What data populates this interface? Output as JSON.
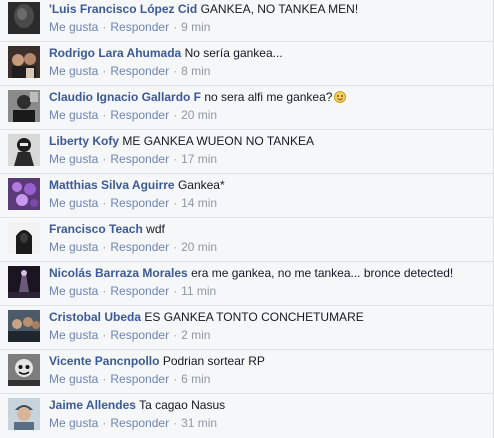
{
  "comments": [
    {
      "author": "'Luis Francisco López Cid",
      "text": "GANKEA, NO TANKEA MEN!",
      "like": "Me gusta",
      "reply": "Responder",
      "time": "9 min",
      "avatar": "dark-blur"
    },
    {
      "author": "Rodrigo Lara Ahumada",
      "text": "No sería gankea...",
      "like": "Me gusta",
      "reply": "Responder",
      "time": "8 min",
      "avatar": "person-group"
    },
    {
      "author": "Claudio Ignacio Gallardo F",
      "text": "no sera alfi me gankea?",
      "like": "Me gusta",
      "reply": "Responder",
      "time": "20 min",
      "avatar": "bw-photo",
      "emoji": "tongue-face-icon"
    },
    {
      "author": "Liberty Kofy",
      "text": "ME GANKEA WUEON NO TANKEA",
      "like": "Me gusta",
      "reply": "Responder",
      "time": "17 min",
      "avatar": "bw-character"
    },
    {
      "author": "Matthias Silva Aguirre",
      "text": "Gankea*",
      "like": "Me gusta",
      "reply": "Responder",
      "time": "14 min",
      "avatar": "purple-flowers"
    },
    {
      "author": "Francisco Teach",
      "text": "wdf",
      "like": "Me gusta",
      "reply": "Responder",
      "time": "20 min",
      "avatar": "hooded-figure"
    },
    {
      "author": "Nicolás Barraza Morales",
      "text": "era me gankea, no me tankea... bronce detected!",
      "like": "Me gusta",
      "reply": "Responder",
      "time": "11 min",
      "avatar": "dark-scene"
    },
    {
      "author": "Cristobal Ubeda",
      "text": "ES GANKEA TONTO CONCHETUMARE",
      "like": "Me gusta",
      "reply": "Responder",
      "time": "2 min",
      "avatar": "group-photo"
    },
    {
      "author": "Vicente Pancnpollo",
      "text": "Podrian sortear RP",
      "like": "Me gusta",
      "reply": "Responder",
      "time": "6 min",
      "avatar": "bw-face"
    },
    {
      "author": "Jaime Allendes",
      "text": "Ta cagao Nasus",
      "like": "Me gusta",
      "reply": "Responder",
      "time": "31 min",
      "avatar": "selfie-cap"
    }
  ],
  "colors": {
    "background": "#f6f7f9",
    "author": "#3b5998",
    "action_link": "#6d84b4",
    "meta": "#9197a3",
    "separator": "#e1e2e3"
  }
}
